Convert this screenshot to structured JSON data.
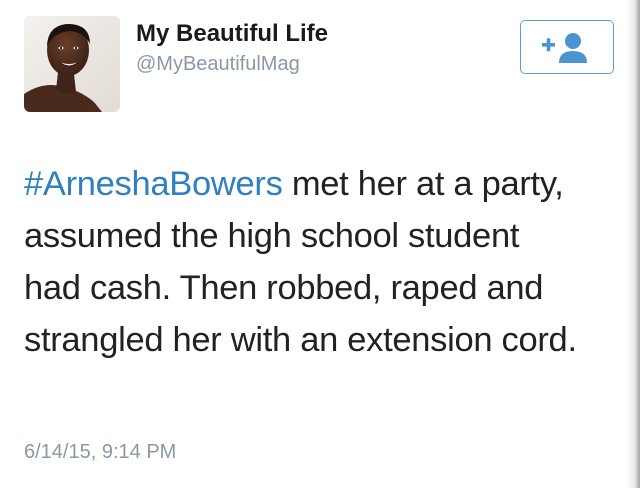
{
  "profile": {
    "display_name": "My Beautiful Life",
    "handle": "@MyBeautifulMag",
    "avatar_icon": "woman-portrait-avatar"
  },
  "follow_button": {
    "label": "+",
    "icon": "add-person-icon",
    "color": "#5aa0d4"
  },
  "tweet": {
    "hashtag": "#ArneshaBowers",
    "text": " met her at a party, assumed the high school student had cash. Then robbed, raped and strangled her with an extension cord.",
    "timestamp": "6/14/15, 9:14 PM"
  },
  "colors": {
    "hashtag": "#2e80c0",
    "secondary_text": "#8c98a5",
    "primary_text": "#222222"
  }
}
